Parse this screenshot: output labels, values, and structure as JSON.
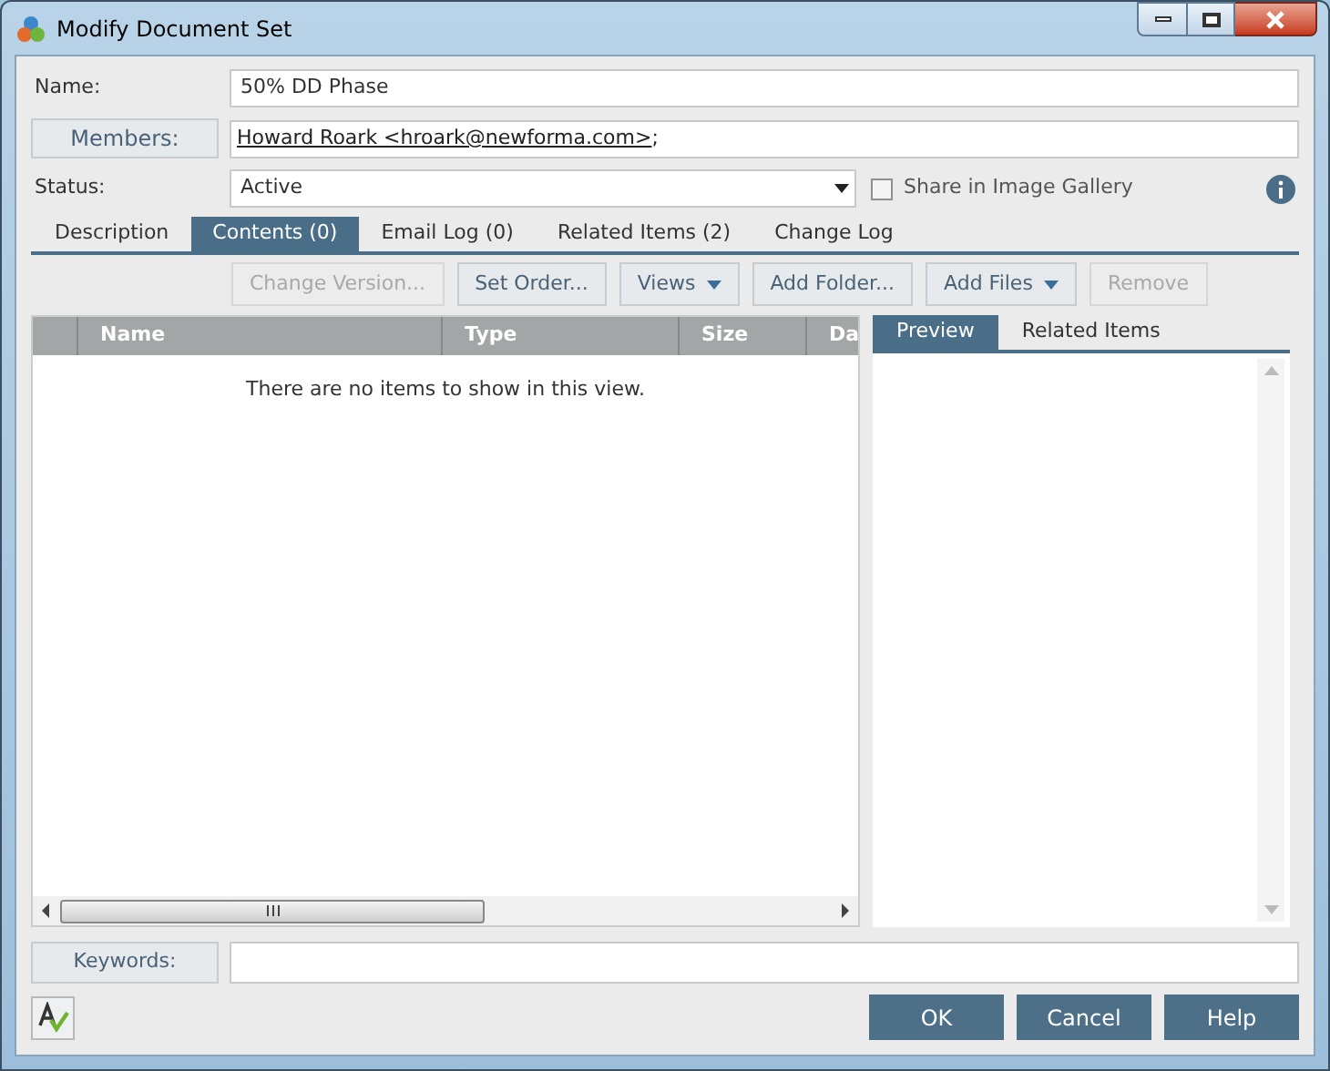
{
  "window": {
    "title": "Modify Document Set"
  },
  "fields": [
    {
      "kind": "text",
      "label": "Name:",
      "value": "50% DD Phase"
    },
    {
      "kind": "members",
      "label": "Members:",
      "value": "Howard Roark <hroark@newforma.com>",
      "suffix": ";"
    },
    {
      "kind": "dropdown",
      "label": "Status:",
      "value": "Active"
    }
  ],
  "share_checkbox": {
    "label": "Share in Image Gallery",
    "checked": false
  },
  "tabs": [
    {
      "label": "Description",
      "selected": false
    },
    {
      "label": "Contents (0)",
      "selected": true
    },
    {
      "label": "Email Log (0)",
      "selected": false
    },
    {
      "label": "Related Items (2)",
      "selected": false
    },
    {
      "label": "Change Log",
      "selected": false
    }
  ],
  "toolbar": [
    {
      "label": "Change Version...",
      "disabled": true,
      "kind": "button"
    },
    {
      "label": "Set Order...",
      "disabled": false,
      "kind": "button"
    },
    {
      "label": "Views",
      "disabled": false,
      "kind": "menu"
    },
    {
      "label": "Add Folder...",
      "disabled": false,
      "kind": "button"
    },
    {
      "label": "Add Files",
      "disabled": false,
      "kind": "menu"
    },
    {
      "label": "Remove",
      "disabled": true,
      "kind": "button"
    }
  ],
  "table": {
    "columns": [
      "Name",
      "Type",
      "Size",
      "Da"
    ],
    "empty_message": "There are no items to show in this view."
  },
  "preview_tabs": [
    {
      "label": "Preview",
      "selected": true
    },
    {
      "label": "Related Items",
      "selected": false
    }
  ],
  "keywords": {
    "label": "Keywords:"
  },
  "buttons": [
    "OK",
    "Cancel",
    "Help"
  ]
}
